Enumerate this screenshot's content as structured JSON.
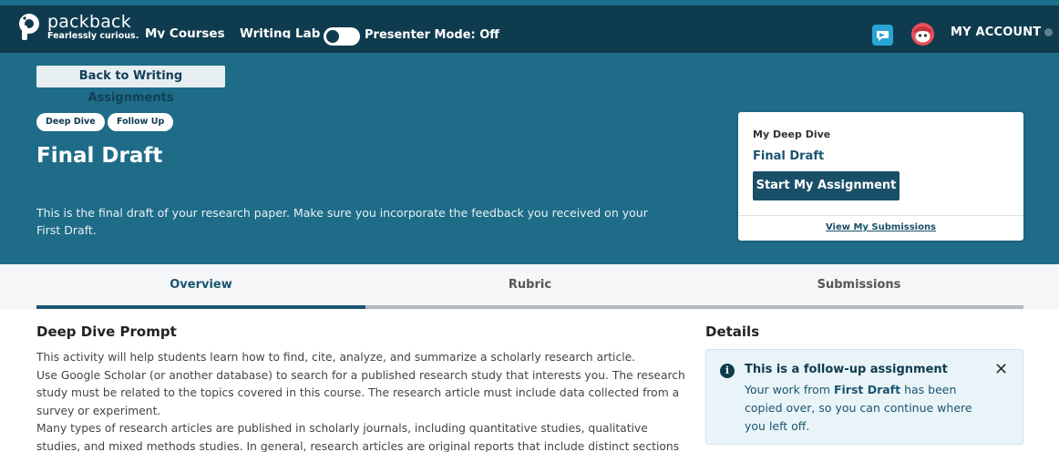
{
  "nav": {
    "brand_name": "packback",
    "brand_tagline": "Fearlessly curious.",
    "my_courses": "My Courses",
    "writing_lab": "Writing Lab",
    "presenter_mode": "Presenter Mode: Off",
    "account": "MY ACCOUNT"
  },
  "hero": {
    "back_label": "Back to Writing Assignments",
    "tags": [
      "Deep Dive",
      "Follow Up"
    ],
    "title": "Final Draft",
    "description": "This is the final draft of your research paper. Make sure you incorporate the feedback you received on your First Draft."
  },
  "card": {
    "label": "My Deep Dive",
    "draft_link": "Final Draft",
    "start_button": "Start My Assignment",
    "view_submissions": "View My Submissions"
  },
  "tabs": [
    "Overview",
    "Rubric",
    "Submissions"
  ],
  "prompt": {
    "title": "Deep Dive Prompt",
    "paragraphs": [
      "This activity will help students learn how to find, cite, analyze, and summarize a scholarly research article.",
      "Use Google Scholar (or another database) to search for a published research study that interests you. The research study must be related to the topics covered in this course. The research article must include data collected from a survey or experiment.",
      "Many types of research articles are published in scholarly journals, including quantitative studies, qualitative studies, and mixed methods studies. In general, research articles are original reports that include distinct sections reflecting the"
    ]
  },
  "details": {
    "title": "Details",
    "info_title": "This is a follow-up assignment",
    "info_body_1": "Your work from ",
    "info_body_bold": "First Draft",
    "info_body_2": " has been copied over, so you can continue where you left off."
  },
  "colors": {
    "navbar": "#0f3b4f",
    "hero": "#1e6c88",
    "accent": "#1a5470",
    "info_bg": "#e9f4f8"
  }
}
